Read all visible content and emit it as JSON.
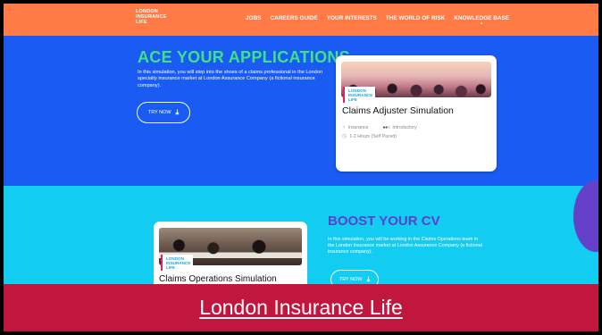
{
  "header": {
    "logo_lines": [
      "LONDON",
      "INSURANCE",
      "LIFE"
    ],
    "menu": [
      "JOBS",
      "CAREERS GUIDE",
      "YOUR INTERESTS",
      "THE WORLD OF RISK",
      "KNOWLEDGE BASE"
    ]
  },
  "section1": {
    "title": "ACE YOUR APPLICATIONS",
    "text": "In this simulation, you will step into the shoes of a claims professional in the London specialty insurance market at London Assurance Company (a fictional insurance company).",
    "button_label": "TRY NOW",
    "card": {
      "badge_lines": [
        "LONDON",
        "INSURANCE",
        "LIFE"
      ],
      "title": "Claims Adjuster Simulation",
      "category": "Insurance",
      "level_dots": "●●○",
      "level": "Introductory",
      "duration": "1-2 Hours (Self Paced)"
    }
  },
  "section2": {
    "title": "BOOST YOUR CV",
    "text": "In this simulation, you will be working in the Claims Operations team in the London Insurance market at London Assurance Company (a fictional insurance company).",
    "button_label": "TRY NOW",
    "card": {
      "badge_lines": [
        "LONDON",
        "INSURANCE",
        "LIFE"
      ],
      "title": "Claims Operations Simulation"
    }
  },
  "banner": {
    "text": "London Insurance Life"
  },
  "colors": {
    "nav": "#ff7a45",
    "section1_bg": "#1a5cf3",
    "section1_title": "#3ee08a",
    "section2_bg": "#13ccf2",
    "section2_title": "#5a43cc",
    "banner_bg": "#c1163d"
  },
  "icons": {
    "button_arrow": "download-arrow-icon",
    "category": "category-icon",
    "clock": "clock-icon"
  }
}
